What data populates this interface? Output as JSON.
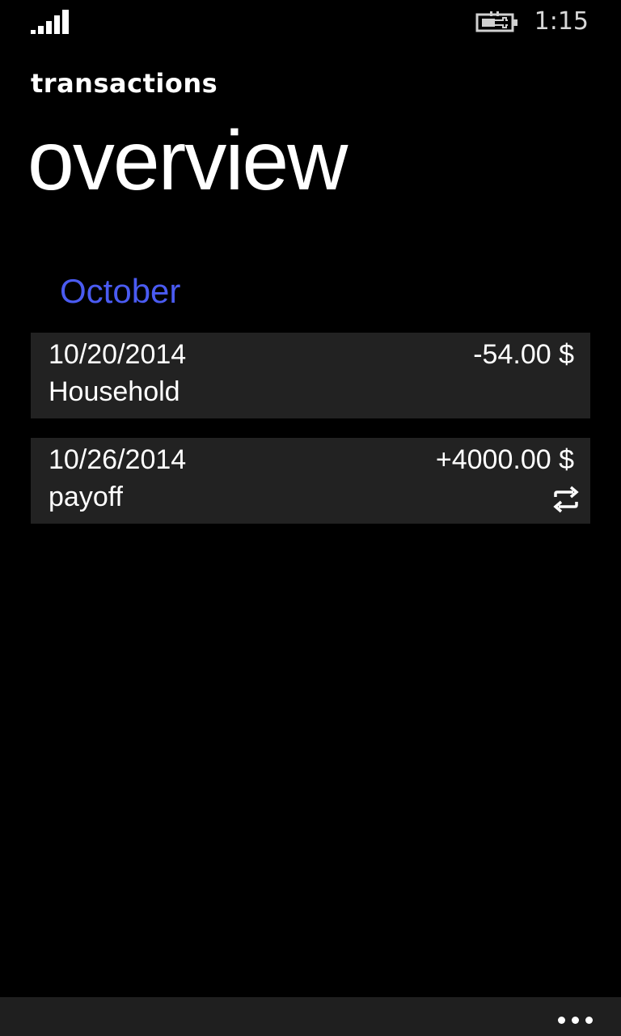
{
  "status_bar": {
    "time": "1:15",
    "signal_icon": "signal-strength-icon",
    "battery_icon": "battery-charging-icon"
  },
  "header": {
    "app_title": "transactions",
    "page_title": "overview"
  },
  "groups": [
    {
      "name": "October",
      "accent_color": "#4a5bf2",
      "transactions": [
        {
          "date": "10/20/2014",
          "category": "Household",
          "amount": "-54.00 $",
          "recurring": false
        },
        {
          "date": "10/26/2014",
          "category": "payoff",
          "amount": "+4000.00 $",
          "recurring": true,
          "icon": "repeat-icon"
        }
      ]
    }
  ],
  "app_bar": {
    "more_icon": "more-dots-icon"
  }
}
